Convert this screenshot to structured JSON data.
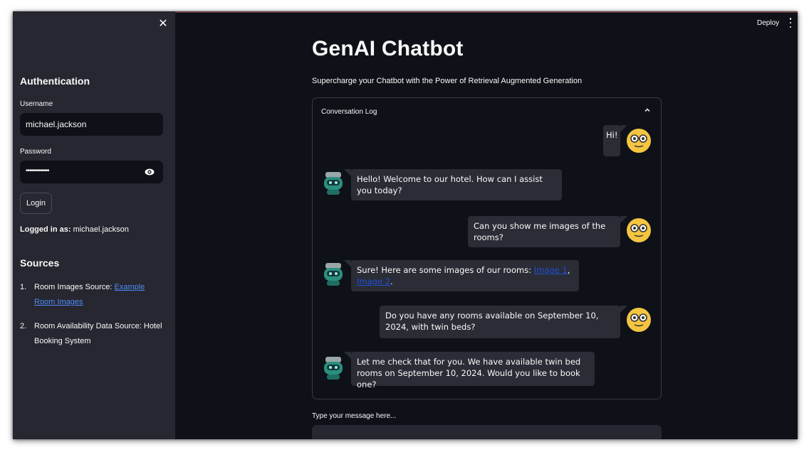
{
  "sidebar": {
    "close_icon": "close-icon",
    "auth_heading": "Authentication",
    "username_label": "Username",
    "username_value": "michael.jackson",
    "password_label": "Password",
    "password_value": "•••••••••••••",
    "password_toggle_icon": "eye-icon",
    "login_label": "Login",
    "logged_in_prefix": "Logged in as:",
    "logged_in_user": "michael.jackson",
    "sources_heading": "Sources",
    "sources": [
      {
        "num": "1.",
        "text": "Room Images Source: ",
        "link": "Example Room Images"
      },
      {
        "num": "2.",
        "text": "Room Availability Data Source: Hotel Booking System",
        "link": ""
      }
    ]
  },
  "header": {
    "deploy_label": "Deploy",
    "menu_icon": "kebab-menu-icon"
  },
  "main": {
    "title": "GenAI Chatbot",
    "subtitle": "Supercharge your Chatbot with the Power of Retrieval Augmented Generation",
    "log_title": "Conversation Log",
    "collapse_icon": "chevron-up-icon",
    "messages": [
      {
        "role": "user",
        "text": "Hi!"
      },
      {
        "role": "bot",
        "text": "Hello! Welcome to our hotel. How can I assist you today?"
      },
      {
        "role": "user",
        "text": "Can you show me images of the rooms?"
      },
      {
        "role": "bot",
        "text": "Sure! Here are some images of our rooms: ",
        "link1": "Image 1",
        "sep": ", ",
        "link2": "Image 2",
        "end": "."
      },
      {
        "role": "user",
        "text": "Do you have any rooms available on September 10, 2024, with twin beds?"
      },
      {
        "role": "bot",
        "text": "Let me check that for you. We have available twin bed rooms on September 10, 2024. Would you like to book one?"
      }
    ],
    "input_label": "Type your message here...",
    "input_value": ""
  },
  "colors": {
    "app_bg": "#0e1117",
    "sidebar_bg": "#262730",
    "bubble_bg": "#2b2d36",
    "link": "#4f8cf7",
    "user_avatar": "#f5c542",
    "bot_avatar": "#2a8f7e"
  }
}
